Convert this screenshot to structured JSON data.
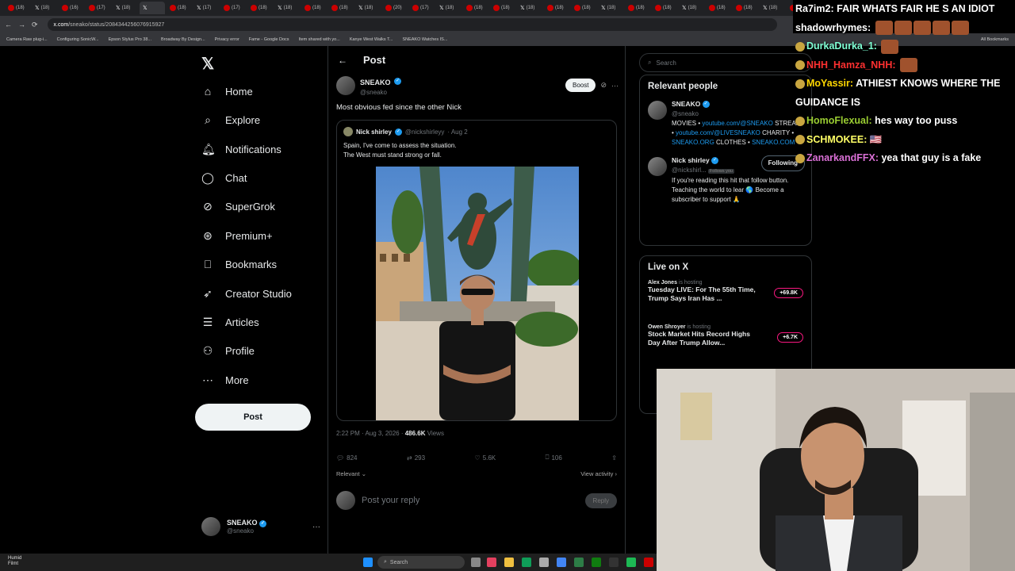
{
  "browser": {
    "tabs": [
      "(18)",
      "(18)",
      "(16)",
      "(17)",
      "(18)",
      "",
      "(18)",
      "(17)",
      "(17)",
      "(18)",
      "(18)",
      "(18)",
      "(18)",
      "(18)",
      "(20)",
      "(17)",
      "(18)",
      "(18)",
      "(18)",
      "(18)",
      "(18)",
      "(18)",
      "(18)",
      "(18)",
      "(18)",
      "(18)",
      "(18)",
      "(18)",
      "(18)",
      "(18)",
      "Tab"
    ],
    "url_domain": "x.com",
    "url_path": "/sneako/status/2084344256076915927",
    "bookmarks": [
      "Camera Raw plug-i...",
      "Configuring SonicW...",
      "Epson Stylus Pro 38...",
      "Broadway By Design...",
      "Privacy error",
      "Fame - Google Docs",
      "Item shared with yo...",
      "Kanye West Walks T...",
      "SNEAKO Watches IS..."
    ],
    "all_bookmarks": "All Bookmarks"
  },
  "nav": {
    "items": [
      {
        "label": "Home",
        "icon": "home-icon"
      },
      {
        "label": "Explore",
        "icon": "search-icon"
      },
      {
        "label": "Notifications",
        "icon": "bell-icon"
      },
      {
        "label": "Chat",
        "icon": "chat-icon"
      },
      {
        "label": "SuperGrok",
        "icon": "grok-icon"
      },
      {
        "label": "Premium+",
        "icon": "premium-icon"
      },
      {
        "label": "Bookmarks",
        "icon": "bookmark-icon"
      },
      {
        "label": "Creator Studio",
        "icon": "rocket-icon"
      },
      {
        "label": "Articles",
        "icon": "article-icon"
      },
      {
        "label": "Profile",
        "icon": "person-icon"
      },
      {
        "label": "More",
        "icon": "more-icon"
      }
    ],
    "post_button": "Post",
    "account": {
      "name": "SNEAKO",
      "handle": "@sneako"
    }
  },
  "post": {
    "header": "Post",
    "author": {
      "name": "SNEAKO",
      "handle": "@sneako"
    },
    "boost_label": "Boost",
    "text": "Most obvious fed since the other Nick",
    "quote": {
      "name": "Nick shirley",
      "handle": "@nickshirleyy",
      "date": "· Aug 2",
      "line1": "Spain, I've come to assess the situation.",
      "line2": "The West must stand strong or fall."
    },
    "time": "2:22 PM · Aug 3, 2026 ·",
    "views": "486.6K",
    "views_label": "Views",
    "stats": {
      "replies": "824",
      "reposts": "293",
      "likes": "5.6K",
      "bookmarks": "106"
    },
    "sort_label": "Relevant",
    "view_activity": "View activity",
    "reply_placeholder": "Post your reply",
    "reply_button": "Reply"
  },
  "right": {
    "search_placeholder": "Search",
    "relevant_title": "Relevant people",
    "people": [
      {
        "name": "SNEAKO",
        "handle": "@sneako",
        "bio_a": "MOVIES •",
        "link_a": "youtube.com/@SNEAKO",
        "bio_b": "STREAM •",
        "link_b": "youtube.com/@LIVESNEAKO",
        "bio_c": "CHARITY •",
        "link_c": "SNEAKO.ORG",
        "bio_d": "CLOTHES •",
        "link_d": "SNEAKO.COM"
      },
      {
        "name": "Nick shirley",
        "handle": "@nickshirl...",
        "follows_you": "Follows you",
        "follow_label": "Following",
        "bio": "If you're reading this hit that follow button. Teaching the world to lear 🌎 Become a subscriber to support 🙏"
      }
    ],
    "live_title": "Live on X",
    "live": [
      {
        "host": "Alex Jones",
        "status": "is hosting",
        "title": "Tuesday LIVE: For The 55th Time, Trump Says Iran Has ...",
        "count": "+69.8K"
      },
      {
        "host": "Owen Shroyer",
        "status": "is hosting",
        "title": "Stock Market Hits Record Highs Day After Trump Allow...",
        "count": "+6.7K"
      }
    ]
  },
  "chat": [
    {
      "user": "Ra7im2:",
      "text": "FAIR WHATS FAIR HE S AN IDIOT",
      "color": "#ffffff"
    },
    {
      "user": "shadowrhymes:",
      "text": "",
      "color": "#ffffff"
    },
    {
      "user": "DurkaDurka_1:",
      "text": "",
      "color": "#7fffd4"
    },
    {
      "user": "NHH_Hamza_NHH:",
      "text": "",
      "color": "#ff3030"
    },
    {
      "user": "MoYassir:",
      "text": "ATHIEST KNOWS WHERE THE GUIDANCE IS",
      "color": "#ffd700"
    },
    {
      "user": "HomoFlexual:",
      "text": "hes way too puss",
      "color": "#9acd32"
    },
    {
      "user": "SCHMOKEE:",
      "text": "🇺🇸",
      "color": "#ffff66"
    },
    {
      "user": "ZanarkandFFX:",
      "text": "yea that guy is a fake",
      "color": "#da70d6"
    }
  ],
  "taskbar": {
    "weather_temp": "Humid",
    "weather_sub": "Filmt",
    "search": "Search"
  },
  "colors": {
    "accent": "#1d9bf0",
    "live": "#f91880",
    "bg": "#000000"
  }
}
